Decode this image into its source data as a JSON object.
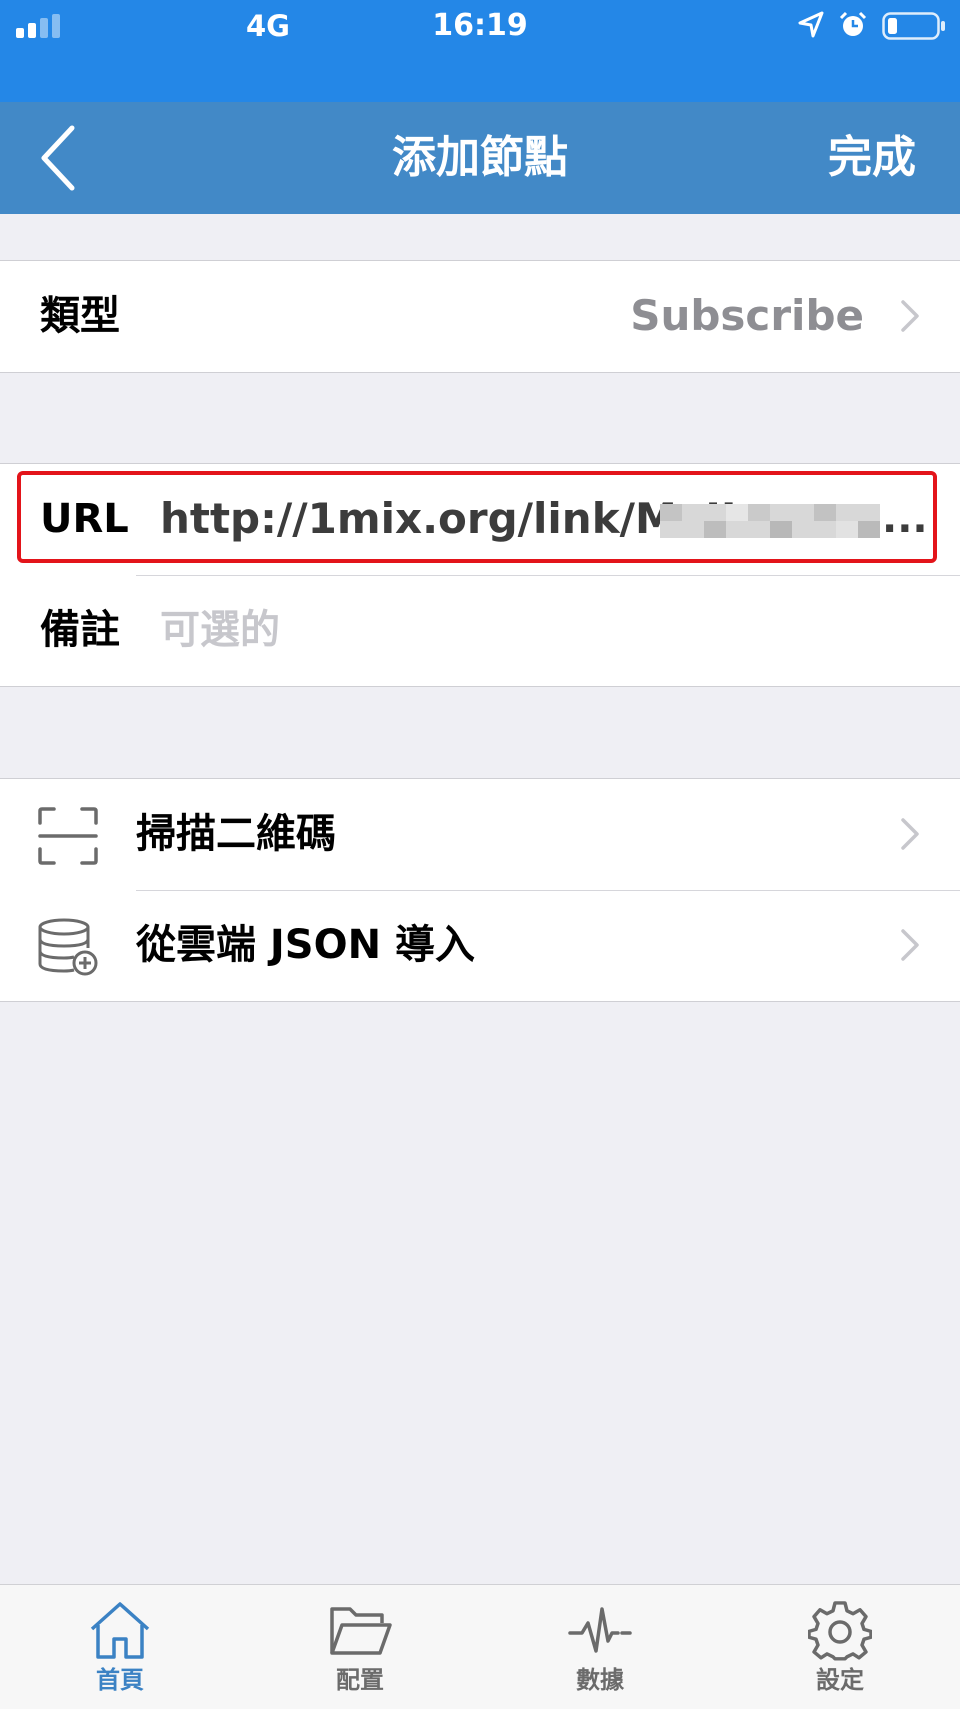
{
  "status_bar": {
    "carrier": "4G",
    "time": "16:19"
  },
  "nav": {
    "title": "添加節點",
    "done_label": "完成"
  },
  "type_row": {
    "label": "類型",
    "value": "Subscribe"
  },
  "url_row": {
    "label": "URL",
    "value": "http://1mix.org/link/MeIIw",
    "ellipsis": "..."
  },
  "note_row": {
    "label": "備註",
    "placeholder": "可選的"
  },
  "actions": [
    {
      "label": "掃描二維碼",
      "icon": "scan-qr-icon"
    },
    {
      "label": "從雲端 JSON 導入",
      "icon": "database-add-icon"
    }
  ],
  "tabs": [
    {
      "label": "首頁",
      "icon": "home-icon",
      "active": true
    },
    {
      "label": "配置",
      "icon": "folder-icon",
      "active": false
    },
    {
      "label": "數據",
      "icon": "pulse-icon",
      "active": false
    },
    {
      "label": "設定",
      "icon": "gear-icon",
      "active": false
    }
  ],
  "colors": {
    "status_bar": "#2487e7",
    "nav_bar": "#4289c7",
    "highlight": "#e3141a",
    "tab_active": "#3b82c4"
  }
}
